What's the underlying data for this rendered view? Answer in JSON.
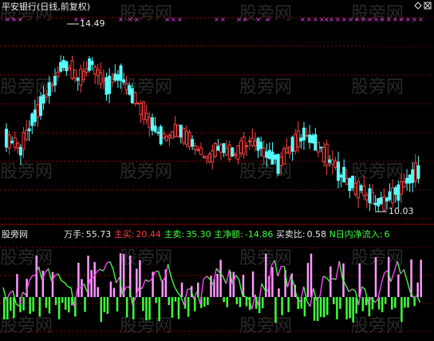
{
  "main_panel": {
    "title": "平安银行(日线,前复权)",
    "high_label": "14.49",
    "low_label": "10.03"
  },
  "sub_panel": {
    "name": "股旁网",
    "items": [
      {
        "label": "万手:",
        "value": "55.73",
        "color": "#e8e8e8"
      },
      {
        "label": "主买:",
        "value": "20.44",
        "color": "#ff3b3b"
      },
      {
        "label": "主卖:",
        "value": "35.30",
        "color": "#3cff3c"
      },
      {
        "label": "主净额:",
        "value": "-14.86",
        "color": "#3cff3c"
      },
      {
        "label": "买卖比:",
        "value": "0.58",
        "color": "#e8e8e8"
      },
      {
        "label": "N日内净流入:",
        "value": "6",
        "color": "#3cff3c"
      }
    ]
  },
  "watermark_text": "股旁网",
  "colors": {
    "up": "#ff4040",
    "down": "#54ffff",
    "signal": "#ff40ff",
    "volume_up": "#ff99ff",
    "volume_down": "#3cff3c",
    "grid": "#8b0000",
    "text": "#e8e8e8"
  },
  "chart_data": {
    "type": "candlestick",
    "title": "平安银行(日线,前复权)",
    "price_high": 14.49,
    "price_low": 10.03,
    "candles": [
      {
        "o": 11.3,
        "c": 11.8,
        "h": 12.0,
        "l": 11.1
      },
      {
        "o": 11.8,
        "c": 11.5,
        "h": 12.1,
        "l": 11.2
      },
      {
        "o": 11.5,
        "c": 12.3,
        "h": 12.5,
        "l": 11.4
      },
      {
        "o": 12.3,
        "c": 12.9,
        "h": 13.2,
        "l": 12.1
      },
      {
        "o": 12.9,
        "c": 13.6,
        "h": 14.49,
        "l": 12.7
      },
      {
        "o": 13.6,
        "c": 13.2,
        "h": 14.0,
        "l": 12.9
      },
      {
        "o": 13.2,
        "c": 13.5,
        "h": 13.8,
        "l": 12.8
      },
      {
        "o": 13.5,
        "c": 13.0,
        "h": 13.7,
        "l": 12.7
      },
      {
        "o": 13.0,
        "c": 13.3,
        "h": 13.6,
        "l": 12.8
      },
      {
        "o": 13.3,
        "c": 12.7,
        "h": 13.4,
        "l": 12.4
      },
      {
        "o": 12.7,
        "c": 12.2,
        "h": 12.9,
        "l": 11.9
      },
      {
        "o": 12.2,
        "c": 11.8,
        "h": 12.4,
        "l": 11.5
      },
      {
        "o": 11.8,
        "c": 12.0,
        "h": 12.3,
        "l": 11.6
      },
      {
        "o": 12.0,
        "c": 11.7,
        "h": 12.2,
        "l": 11.4
      },
      {
        "o": 11.7,
        "c": 11.3,
        "h": 11.9,
        "l": 11.0
      },
      {
        "o": 11.3,
        "c": 11.6,
        "h": 11.9,
        "l": 11.1
      },
      {
        "o": 11.6,
        "c": 11.4,
        "h": 11.8,
        "l": 11.2
      },
      {
        "o": 11.4,
        "c": 11.7,
        "h": 12.0,
        "l": 11.3
      },
      {
        "o": 11.7,
        "c": 11.5,
        "h": 11.9,
        "l": 11.3
      },
      {
        "o": 11.5,
        "c": 11.2,
        "h": 11.6,
        "l": 10.9
      },
      {
        "o": 11.2,
        "c": 11.6,
        "h": 11.9,
        "l": 11.1
      },
      {
        "o": 11.6,
        "c": 11.9,
        "h": 12.1,
        "l": 11.5
      },
      {
        "o": 11.9,
        "c": 11.5,
        "h": 12.0,
        "l": 11.3
      },
      {
        "o": 11.5,
        "c": 11.1,
        "h": 11.6,
        "l": 10.9
      },
      {
        "o": 11.1,
        "c": 10.7,
        "h": 11.2,
        "l": 10.5
      },
      {
        "o": 10.7,
        "c": 10.5,
        "h": 10.9,
        "l": 10.2
      },
      {
        "o": 10.5,
        "c": 10.2,
        "h": 10.7,
        "l": 10.03
      },
      {
        "o": 10.2,
        "c": 10.4,
        "h": 10.6,
        "l": 10.1
      },
      {
        "o": 10.4,
        "c": 10.7,
        "h": 10.9,
        "l": 10.3
      },
      {
        "o": 10.7,
        "c": 11.1,
        "h": 11.3,
        "l": 10.6
      }
    ]
  }
}
